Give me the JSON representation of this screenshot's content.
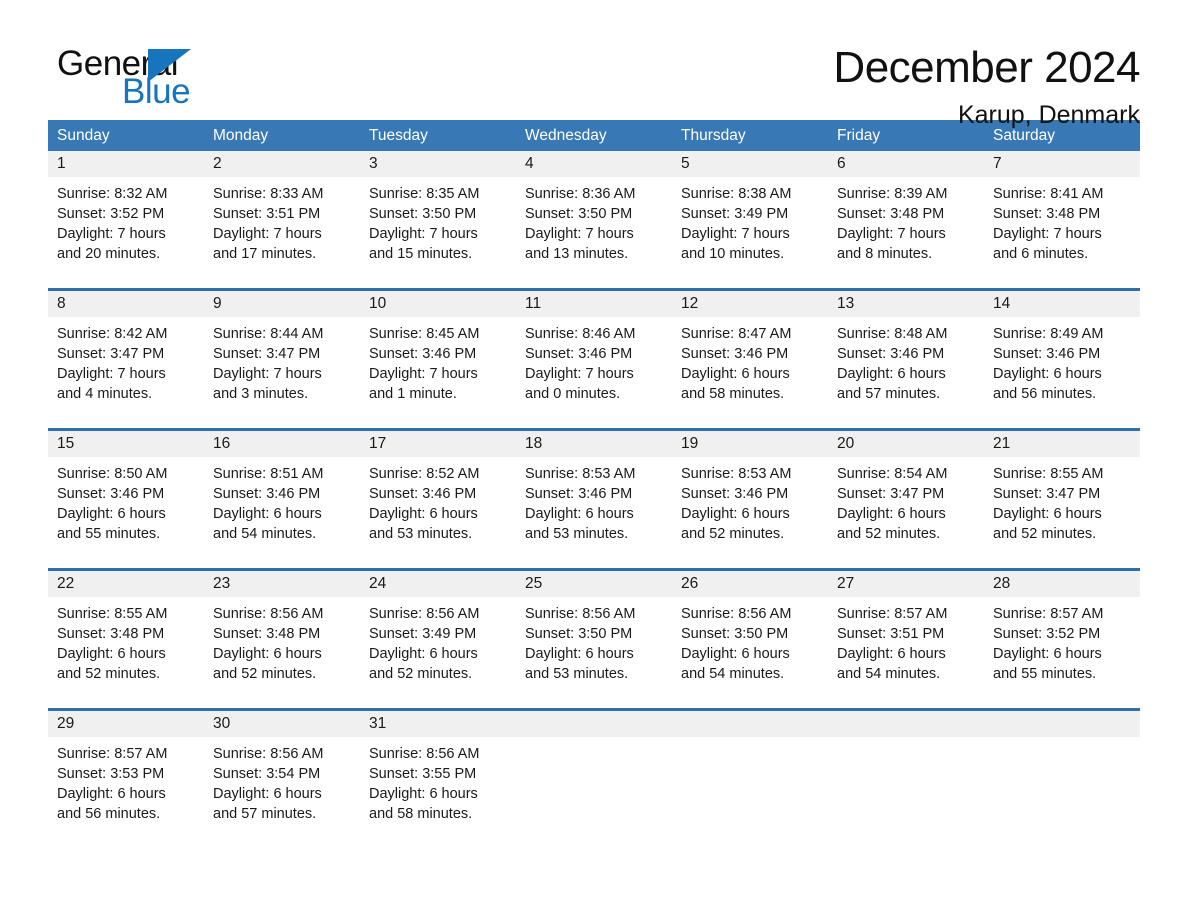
{
  "brand": {
    "name_part1": "General",
    "name_part2": "Blue",
    "logo_icon": "triangle-icon",
    "accent_color": "#1675bd"
  },
  "header": {
    "title": "December 2024",
    "location": "Karup, Denmark"
  },
  "theme": {
    "header_bg": "#3878b4",
    "row_rule": "#2f6fab",
    "daynum_bg": "#f0f0f0",
    "text": "#1a1a1a"
  },
  "calendar": {
    "weekdays": [
      "Sunday",
      "Monday",
      "Tuesday",
      "Wednesday",
      "Thursday",
      "Friday",
      "Saturday"
    ],
    "weeks": [
      [
        {
          "day": "1",
          "sunrise": "Sunrise: 8:32 AM",
          "sunset": "Sunset: 3:52 PM",
          "daylight1": "Daylight: 7 hours",
          "daylight2": "and 20 minutes."
        },
        {
          "day": "2",
          "sunrise": "Sunrise: 8:33 AM",
          "sunset": "Sunset: 3:51 PM",
          "daylight1": "Daylight: 7 hours",
          "daylight2": "and 17 minutes."
        },
        {
          "day": "3",
          "sunrise": "Sunrise: 8:35 AM",
          "sunset": "Sunset: 3:50 PM",
          "daylight1": "Daylight: 7 hours",
          "daylight2": "and 15 minutes."
        },
        {
          "day": "4",
          "sunrise": "Sunrise: 8:36 AM",
          "sunset": "Sunset: 3:50 PM",
          "daylight1": "Daylight: 7 hours",
          "daylight2": "and 13 minutes."
        },
        {
          "day": "5",
          "sunrise": "Sunrise: 8:38 AM",
          "sunset": "Sunset: 3:49 PM",
          "daylight1": "Daylight: 7 hours",
          "daylight2": "and 10 minutes."
        },
        {
          "day": "6",
          "sunrise": "Sunrise: 8:39 AM",
          "sunset": "Sunset: 3:48 PM",
          "daylight1": "Daylight: 7 hours",
          "daylight2": "and 8 minutes."
        },
        {
          "day": "7",
          "sunrise": "Sunrise: 8:41 AM",
          "sunset": "Sunset: 3:48 PM",
          "daylight1": "Daylight: 7 hours",
          "daylight2": "and 6 minutes."
        }
      ],
      [
        {
          "day": "8",
          "sunrise": "Sunrise: 8:42 AM",
          "sunset": "Sunset: 3:47 PM",
          "daylight1": "Daylight: 7 hours",
          "daylight2": "and 4 minutes."
        },
        {
          "day": "9",
          "sunrise": "Sunrise: 8:44 AM",
          "sunset": "Sunset: 3:47 PM",
          "daylight1": "Daylight: 7 hours",
          "daylight2": "and 3 minutes."
        },
        {
          "day": "10",
          "sunrise": "Sunrise: 8:45 AM",
          "sunset": "Sunset: 3:46 PM",
          "daylight1": "Daylight: 7 hours",
          "daylight2": "and 1 minute."
        },
        {
          "day": "11",
          "sunrise": "Sunrise: 8:46 AM",
          "sunset": "Sunset: 3:46 PM",
          "daylight1": "Daylight: 7 hours",
          "daylight2": "and 0 minutes."
        },
        {
          "day": "12",
          "sunrise": "Sunrise: 8:47 AM",
          "sunset": "Sunset: 3:46 PM",
          "daylight1": "Daylight: 6 hours",
          "daylight2": "and 58 minutes."
        },
        {
          "day": "13",
          "sunrise": "Sunrise: 8:48 AM",
          "sunset": "Sunset: 3:46 PM",
          "daylight1": "Daylight: 6 hours",
          "daylight2": "and 57 minutes."
        },
        {
          "day": "14",
          "sunrise": "Sunrise: 8:49 AM",
          "sunset": "Sunset: 3:46 PM",
          "daylight1": "Daylight: 6 hours",
          "daylight2": "and 56 minutes."
        }
      ],
      [
        {
          "day": "15",
          "sunrise": "Sunrise: 8:50 AM",
          "sunset": "Sunset: 3:46 PM",
          "daylight1": "Daylight: 6 hours",
          "daylight2": "and 55 minutes."
        },
        {
          "day": "16",
          "sunrise": "Sunrise: 8:51 AM",
          "sunset": "Sunset: 3:46 PM",
          "daylight1": "Daylight: 6 hours",
          "daylight2": "and 54 minutes."
        },
        {
          "day": "17",
          "sunrise": "Sunrise: 8:52 AM",
          "sunset": "Sunset: 3:46 PM",
          "daylight1": "Daylight: 6 hours",
          "daylight2": "and 53 minutes."
        },
        {
          "day": "18",
          "sunrise": "Sunrise: 8:53 AM",
          "sunset": "Sunset: 3:46 PM",
          "daylight1": "Daylight: 6 hours",
          "daylight2": "and 53 minutes."
        },
        {
          "day": "19",
          "sunrise": "Sunrise: 8:53 AM",
          "sunset": "Sunset: 3:46 PM",
          "daylight1": "Daylight: 6 hours",
          "daylight2": "and 52 minutes."
        },
        {
          "day": "20",
          "sunrise": "Sunrise: 8:54 AM",
          "sunset": "Sunset: 3:47 PM",
          "daylight1": "Daylight: 6 hours",
          "daylight2": "and 52 minutes."
        },
        {
          "day": "21",
          "sunrise": "Sunrise: 8:55 AM",
          "sunset": "Sunset: 3:47 PM",
          "daylight1": "Daylight: 6 hours",
          "daylight2": "and 52 minutes."
        }
      ],
      [
        {
          "day": "22",
          "sunrise": "Sunrise: 8:55 AM",
          "sunset": "Sunset: 3:48 PM",
          "daylight1": "Daylight: 6 hours",
          "daylight2": "and 52 minutes."
        },
        {
          "day": "23",
          "sunrise": "Sunrise: 8:56 AM",
          "sunset": "Sunset: 3:48 PM",
          "daylight1": "Daylight: 6 hours",
          "daylight2": "and 52 minutes."
        },
        {
          "day": "24",
          "sunrise": "Sunrise: 8:56 AM",
          "sunset": "Sunset: 3:49 PM",
          "daylight1": "Daylight: 6 hours",
          "daylight2": "and 52 minutes."
        },
        {
          "day": "25",
          "sunrise": "Sunrise: 8:56 AM",
          "sunset": "Sunset: 3:50 PM",
          "daylight1": "Daylight: 6 hours",
          "daylight2": "and 53 minutes."
        },
        {
          "day": "26",
          "sunrise": "Sunrise: 8:56 AM",
          "sunset": "Sunset: 3:50 PM",
          "daylight1": "Daylight: 6 hours",
          "daylight2": "and 54 minutes."
        },
        {
          "day": "27",
          "sunrise": "Sunrise: 8:57 AM",
          "sunset": "Sunset: 3:51 PM",
          "daylight1": "Daylight: 6 hours",
          "daylight2": "and 54 minutes."
        },
        {
          "day": "28",
          "sunrise": "Sunrise: 8:57 AM",
          "sunset": "Sunset: 3:52 PM",
          "daylight1": "Daylight: 6 hours",
          "daylight2": "and 55 minutes."
        }
      ],
      [
        {
          "day": "29",
          "sunrise": "Sunrise: 8:57 AM",
          "sunset": "Sunset: 3:53 PM",
          "daylight1": "Daylight: 6 hours",
          "daylight2": "and 56 minutes."
        },
        {
          "day": "30",
          "sunrise": "Sunrise: 8:56 AM",
          "sunset": "Sunset: 3:54 PM",
          "daylight1": "Daylight: 6 hours",
          "daylight2": "and 57 minutes."
        },
        {
          "day": "31",
          "sunrise": "Sunrise: 8:56 AM",
          "sunset": "Sunset: 3:55 PM",
          "daylight1": "Daylight: 6 hours",
          "daylight2": "and 58 minutes."
        },
        {
          "day": "",
          "sunrise": "",
          "sunset": "",
          "daylight1": "",
          "daylight2": ""
        },
        {
          "day": "",
          "sunrise": "",
          "sunset": "",
          "daylight1": "",
          "daylight2": ""
        },
        {
          "day": "",
          "sunrise": "",
          "sunset": "",
          "daylight1": "",
          "daylight2": ""
        },
        {
          "day": "",
          "sunrise": "",
          "sunset": "",
          "daylight1": "",
          "daylight2": ""
        }
      ]
    ]
  }
}
